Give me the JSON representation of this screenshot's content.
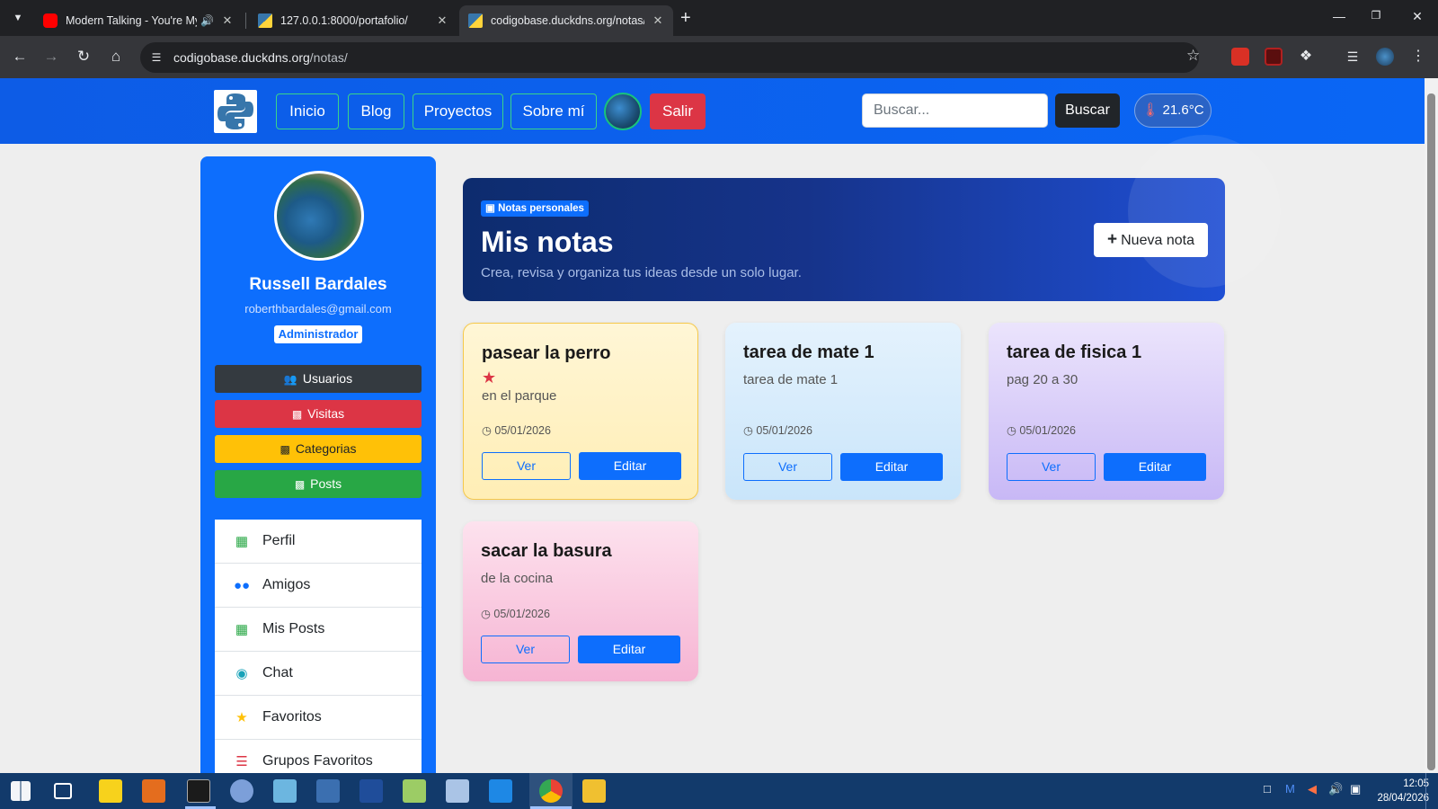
{
  "browser": {
    "tabs": [
      {
        "title": "Modern Talking - You're My",
        "favicon": "youtube-icon",
        "active": false
      },
      {
        "title": "127.0.0.1:8000/portafolio/",
        "favicon": "python-logo-icon",
        "active": false
      },
      {
        "title": "codigobase.duckdns.org/notas/",
        "favicon": "python-logo-icon",
        "active": true
      }
    ],
    "url_host": "codigobase.duckdns.org",
    "url_path": "/notas/"
  },
  "navbar": {
    "links": [
      "Inicio",
      "Blog",
      "Proyectos",
      "Sobre mí"
    ],
    "logout_label": "Salir",
    "search_placeholder": "Buscar...",
    "search_button": "Buscar",
    "temperature": "21.6°C"
  },
  "profile": {
    "name": "Russell Bardales",
    "email": "roberthbardales@gmail.com",
    "role": "Administrador"
  },
  "admin_buttons": [
    {
      "label": "Usuarios",
      "icon": "users-icon",
      "color": "#343a40"
    },
    {
      "label": "Visitas",
      "icon": "chart-icon",
      "color": "#dc3545"
    },
    {
      "label": "Categorias",
      "icon": "chart-icon",
      "color": "#ffc107"
    },
    {
      "label": "Posts",
      "icon": "chart-icon",
      "color": "#28a745"
    }
  ],
  "menu": [
    {
      "label": "Perfil",
      "icon": "clipboard-icon"
    },
    {
      "label": "Amigos",
      "icon": "users-icon"
    },
    {
      "label": "Mis Posts",
      "icon": "clipboard-icon"
    },
    {
      "label": "Chat",
      "icon": "chat-icon"
    },
    {
      "label": "Favoritos",
      "icon": "star-icon"
    },
    {
      "label": "Grupos Favoritos",
      "icon": "layers-icon"
    }
  ],
  "hero": {
    "badge": "Notas personales",
    "title": "Mis notas",
    "subtitle": "Crea, revisa y organiza tus ideas desde un solo lugar.",
    "new_button": "Nueva nota"
  },
  "notes": [
    {
      "title": "pasear la perro",
      "favorite": true,
      "text": "en el parque",
      "date": "05/01/2026",
      "view": "Ver",
      "edit": "Editar"
    },
    {
      "title": "tarea de mate 1",
      "favorite": false,
      "text": "tarea de mate 1",
      "date": "05/01/2026",
      "view": "Ver",
      "edit": "Editar"
    },
    {
      "title": "tarea de fisica 1",
      "favorite": false,
      "text": "pag 20 a 30",
      "date": "05/01/2026",
      "view": "Ver",
      "edit": "Editar"
    },
    {
      "title": "sacar la basura",
      "favorite": false,
      "text": "de la cocina",
      "date": "05/01/2026",
      "view": "Ver",
      "edit": "Editar"
    }
  ],
  "taskbar": {
    "time": "12:05",
    "date": "28/04/2026"
  },
  "colors": {
    "primary": "#0d6efd",
    "danger": "#dc3545",
    "note_yellow": "#fff3c4",
    "note_blue": "#d6ecfb",
    "note_purple": "#d9cdfa",
    "note_pink": "#fbd3e6"
  }
}
